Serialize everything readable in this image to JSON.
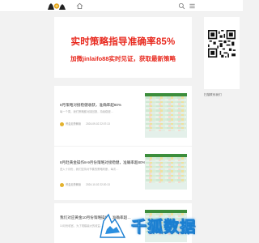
{
  "header": {
    "logo_icon": "silhouette-figures-logo",
    "home_icon": "home-icon",
    "search_icon": "search-icon",
    "menu_icon": "menu-icon"
  },
  "banner": {
    "title": "实时策略指导准确率85%",
    "subtitle": "加微jinlaifo88实时见证，获取最新策略",
    "accent_color": "#e8281d"
  },
  "sidebar": {
    "qr_caption": "扫描联系我们"
  },
  "posts": [
    {
      "title": "8月策略对接稳健收获，准确率超80%",
      "excerpt": "每一个周，我们策略都对接回报，持续稳健…",
      "author": "黄金走势解读",
      "date": "2024-09-02 22:07:13"
    },
    {
      "title": "8月赴黄金操作8-9月份策略对接稳健，准确率超80%",
      "excerpt": "进入十月份，我们坚持对节奏的策略判断，每次…",
      "author": "黄金走势解读",
      "date": "2024-10-02 22:20:13"
    },
    {
      "title": "我们对应黄金10月份策略操作，准确率超…",
      "excerpt": "10月份收官，为了规模最大的收益…",
      "author": "",
      "date": ""
    }
  ],
  "overlay": {
    "text": "千狐数据",
    "accent_color": "#1b7fd1"
  }
}
